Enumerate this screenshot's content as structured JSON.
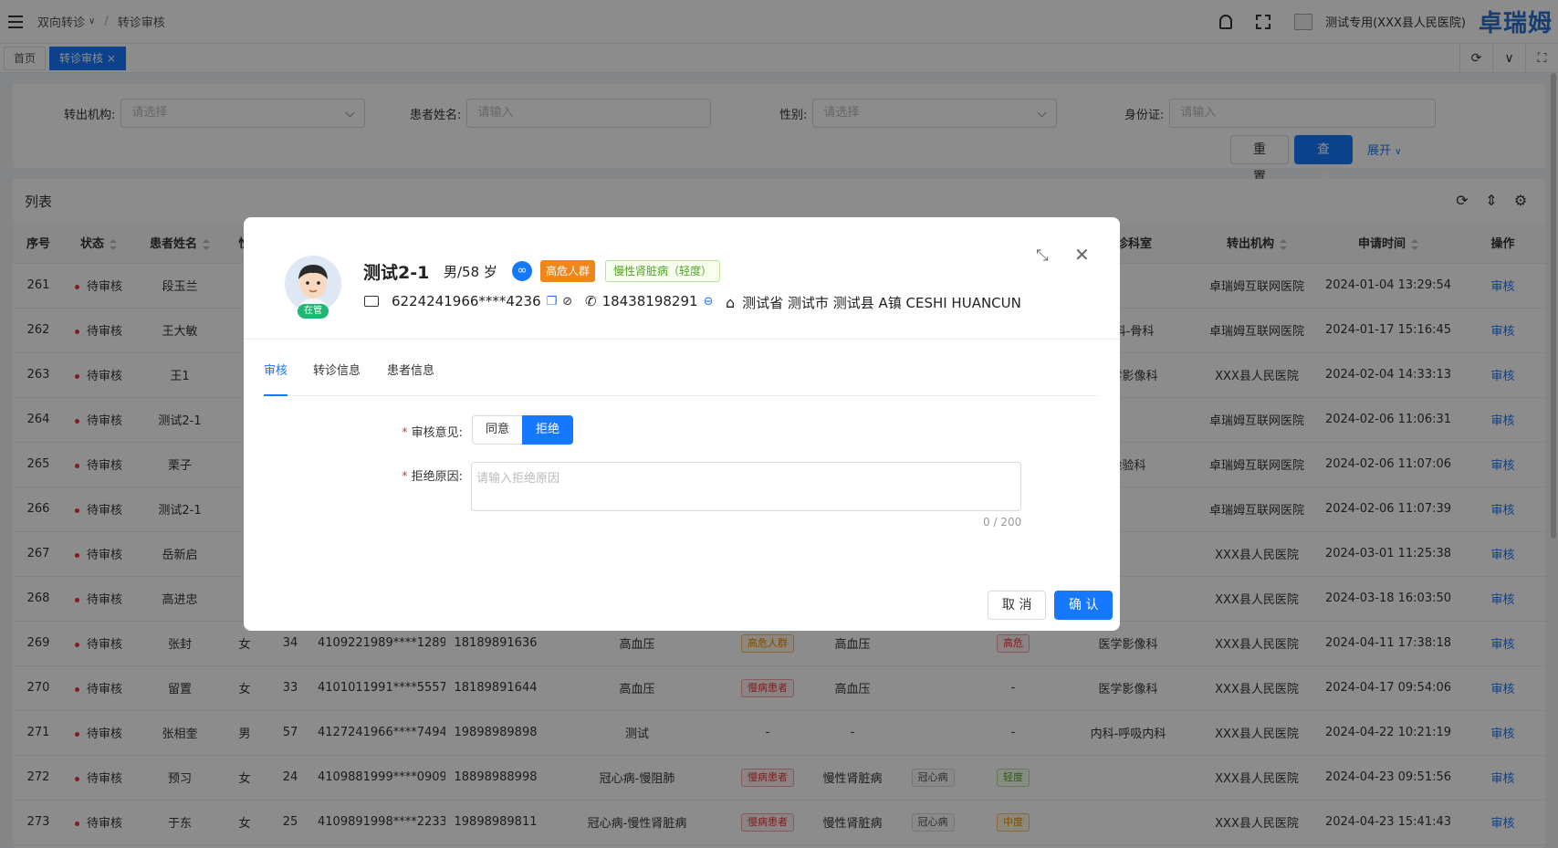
{
  "header": {
    "breadcrumb": [
      "双向转诊",
      "转诊审核"
    ],
    "hospital": "测试专用(XXX县人民医院)",
    "logo": "卓瑞姆"
  },
  "tabs": [
    {
      "label": "首页",
      "active": false
    },
    {
      "label": "转诊审核",
      "active": true,
      "close": "×"
    }
  ],
  "search": {
    "fields": [
      {
        "label": "转出机构:",
        "placeholder": "请选择",
        "type": "select"
      },
      {
        "label": "患者姓名:",
        "placeholder": "请输入",
        "type": "input"
      },
      {
        "label": "性别:",
        "placeholder": "请选择",
        "type": "select"
      },
      {
        "label": "身份证:",
        "placeholder": "请输入",
        "type": "input"
      }
    ],
    "reset_label": "重 置",
    "query_label": "查 询",
    "expand_label": "展开"
  },
  "list": {
    "title": "列表",
    "columns": [
      "序号",
      "状态",
      "患者姓名",
      "性",
      "接诊科室",
      "转出机构",
      "申请时间",
      "操作"
    ],
    "rows": [
      {
        "no": "261",
        "status": "待审核",
        "name": "段玉兰",
        "sex": "",
        "age": "",
        "id": "",
        "phone": "",
        "diag": "",
        "tag1": "",
        "disease": "",
        "tag2": "",
        "level": "",
        "dept": "",
        "org": "卓瑞姆互联网医院",
        "time": "2024-01-04 13:29:54",
        "op": "审核"
      },
      {
        "no": "262",
        "status": "待审核",
        "name": "王大敏",
        "sex": "",
        "age": "",
        "id": "",
        "phone": "",
        "diag": "",
        "tag1": "",
        "disease": "",
        "tag2": "",
        "level": "",
        "dept": "外科-骨科",
        "org": "卓瑞姆互联网医院",
        "time": "2024-01-17 15:16:45",
        "op": "审核"
      },
      {
        "no": "263",
        "status": "待审核",
        "name": "王1",
        "sex": "",
        "age": "",
        "id": "",
        "phone": "",
        "diag": "",
        "tag1": "",
        "disease": "",
        "tag2": "",
        "level": "",
        "dept": "医学影像科",
        "org": "XXX县人民医院",
        "time": "2024-02-04 14:33:13",
        "op": "审核"
      },
      {
        "no": "264",
        "status": "待审核",
        "name": "测试2-1",
        "sex": "",
        "age": "",
        "id": "",
        "phone": "",
        "diag": "",
        "tag1": "",
        "disease": "",
        "tag2": "",
        "level": "",
        "dept": "",
        "org": "卓瑞姆互联网医院",
        "time": "2024-02-06 11:06:31",
        "op": "审核"
      },
      {
        "no": "265",
        "status": "待审核",
        "name": "栗子",
        "sex": "",
        "age": "",
        "id": "",
        "phone": "",
        "diag": "",
        "tag1": "",
        "disease": "",
        "tag2": "",
        "level": "",
        "dept": "检验科",
        "org": "卓瑞姆互联网医院",
        "time": "2024-02-06 11:07:06",
        "op": "审核"
      },
      {
        "no": "266",
        "status": "待审核",
        "name": "测试2-1",
        "sex": "",
        "age": "",
        "id": "",
        "phone": "",
        "diag": "",
        "tag1": "",
        "disease": "",
        "tag2": "",
        "level": "",
        "dept": "",
        "org": "卓瑞姆互联网医院",
        "time": "2024-02-06 11:07:39",
        "op": "审核"
      },
      {
        "no": "267",
        "status": "待审核",
        "name": "岳新启",
        "sex": "",
        "age": "",
        "id": "",
        "phone": "",
        "diag": "",
        "tag1": "",
        "disease": "",
        "tag2": "",
        "level": "",
        "dept": "",
        "org": "XXX县人民医院",
        "time": "2024-03-01 11:25:38",
        "op": "审核"
      },
      {
        "no": "268",
        "status": "待审核",
        "name": "高进忠",
        "sex": "",
        "age": "",
        "id": "",
        "phone": "",
        "diag": "",
        "tag1": "",
        "disease": "",
        "tag2": "",
        "level": "",
        "dept": "",
        "org": "XXX县人民医院",
        "time": "2024-03-18 16:03:50",
        "op": "审核"
      },
      {
        "no": "269",
        "status": "待审核",
        "name": "张封",
        "sex": "女",
        "age": "34",
        "id": "4109221989****1289",
        "phone": "18189891636",
        "diag": "高血压",
        "tag1": "高危人群",
        "tag1c": "orange",
        "disease": "高血压",
        "tag2": "",
        "level": "高危",
        "levelc": "red",
        "dept": "医学影像科",
        "org": "XXX县人民医院",
        "time": "2024-04-11 17:38:18",
        "op": "审核"
      },
      {
        "no": "270",
        "status": "待审核",
        "name": "留置",
        "sex": "女",
        "age": "33",
        "id": "4101011991****5557",
        "phone": "18189891644",
        "diag": "高血压",
        "tag1": "慢病患者",
        "tag1c": "red",
        "disease": "高血压",
        "tag2": "",
        "level": "-",
        "dept": "医学影像科",
        "org": "XXX县人民医院",
        "time": "2024-04-17 09:54:06",
        "op": "审核"
      },
      {
        "no": "271",
        "status": "待审核",
        "name": "张相奎",
        "sex": "男",
        "age": "57",
        "id": "4127241966****7494",
        "phone": "19898989898",
        "diag": "测试",
        "tag1": "-",
        "disease": "-",
        "tag2": "",
        "level": "-",
        "dept": "内科-呼吸内科",
        "org": "XXX县人民医院",
        "time": "2024-04-22 10:21:19",
        "op": "审核"
      },
      {
        "no": "272",
        "status": "待审核",
        "name": "预习",
        "sex": "女",
        "age": "24",
        "id": "4109881999****0909",
        "phone": "18898988998",
        "diag": "冠心病-慢阻肺",
        "tag1": "慢病患者",
        "tag1c": "red",
        "disease": "慢性肾脏病",
        "tag2": "冠心病",
        "level": "轻度",
        "levelc": "green",
        "dept": "",
        "org": "XXX县人民医院",
        "time": "2024-04-23 09:51:56",
        "op": "审核"
      },
      {
        "no": "273",
        "status": "待审核",
        "name": "于东",
        "sex": "女",
        "age": "25",
        "id": "4109891998****2233",
        "phone": "19898989811",
        "diag": "冠心病-慢性肾脏病",
        "tag1": "慢病患者",
        "tag1c": "red",
        "disease": "慢性肾脏病",
        "tag2": "冠心病",
        "level": "中度",
        "levelc": "orange",
        "dept": "",
        "org": "XXX县人民医院",
        "time": "2024-04-23 15:41:43",
        "op": "审核"
      }
    ]
  },
  "modal": {
    "patient": {
      "name": "测试2-1",
      "sex_age": "男/58 岁",
      "badge": "在管",
      "tag_risk": "高危人群",
      "tag_disease": "慢性肾脏病（轻度）",
      "id_card": "6224241966****4236",
      "phone": "18438198291",
      "address": "测试省 测试市 测试县 A镇 CESHI HUANCUN"
    },
    "tabs": [
      {
        "label": "审核",
        "active": true
      },
      {
        "label": "转诊信息",
        "active": false
      },
      {
        "label": "患者信息",
        "active": false
      }
    ],
    "form": {
      "opinion_label": "审核意见:",
      "agree_label": "同意",
      "reject_label": "拒绝",
      "reason_label": "拒绝原因:",
      "reason_placeholder": "请输入拒绝原因",
      "counter": "0 / 200",
      "required_mark": "*"
    },
    "cancel_label": "取 消",
    "confirm_label": "确 认"
  },
  "colors": {
    "primary": "#1677ff",
    "danger": "#e53935",
    "warning": "#f08519",
    "success": "#52a32a"
  }
}
